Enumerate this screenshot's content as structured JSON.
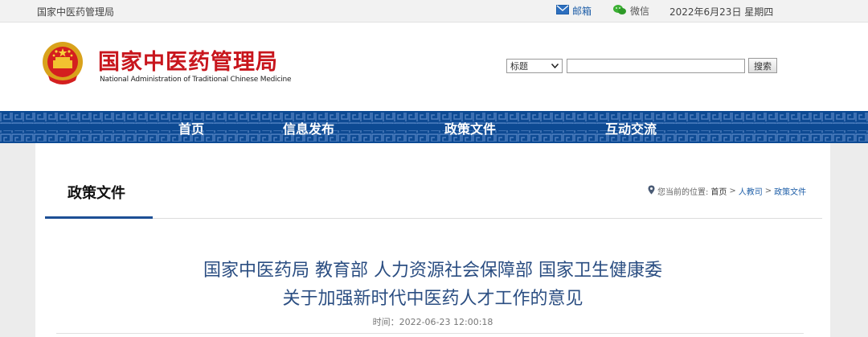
{
  "topbar": {
    "site_name": "国家中医药管理局",
    "mail_label": "邮箱",
    "wechat_label": "微信",
    "date_text": "2022年6月23日 星期四"
  },
  "header": {
    "logo_cn": "国家中医药管理局",
    "logo_en": "National Administration of Traditional Chinese Medicine",
    "search": {
      "select_value": "标题",
      "input_value": "",
      "button_label": "搜索"
    }
  },
  "nav": {
    "items": [
      "首页",
      "信息发布",
      "政策文件",
      "互动交流"
    ]
  },
  "section": {
    "title": "政策文件",
    "breadcrumb": {
      "prefix": "您当前的位置:",
      "items": [
        "首页",
        "人教司",
        "政策文件"
      ],
      "separator": ">"
    }
  },
  "article": {
    "title_line1": "国家中医药局 教育部 人力资源社会保障部 国家卫生健康委",
    "title_line2": "关于加强新时代中医药人才工作的意见",
    "time": "时间：2022-06-23 12:00:18"
  },
  "colors": {
    "nav_bg": "#0d4a93",
    "logo_red": "#c8161d",
    "title_blue": "#2b4e82",
    "link_blue": "#1f5fa8"
  },
  "icons": {
    "mail": "mail-icon",
    "wechat": "wechat-icon",
    "location": "location-pin-icon",
    "emblem": "national-emblem-icon",
    "dropdown": "chevron-down-icon"
  }
}
